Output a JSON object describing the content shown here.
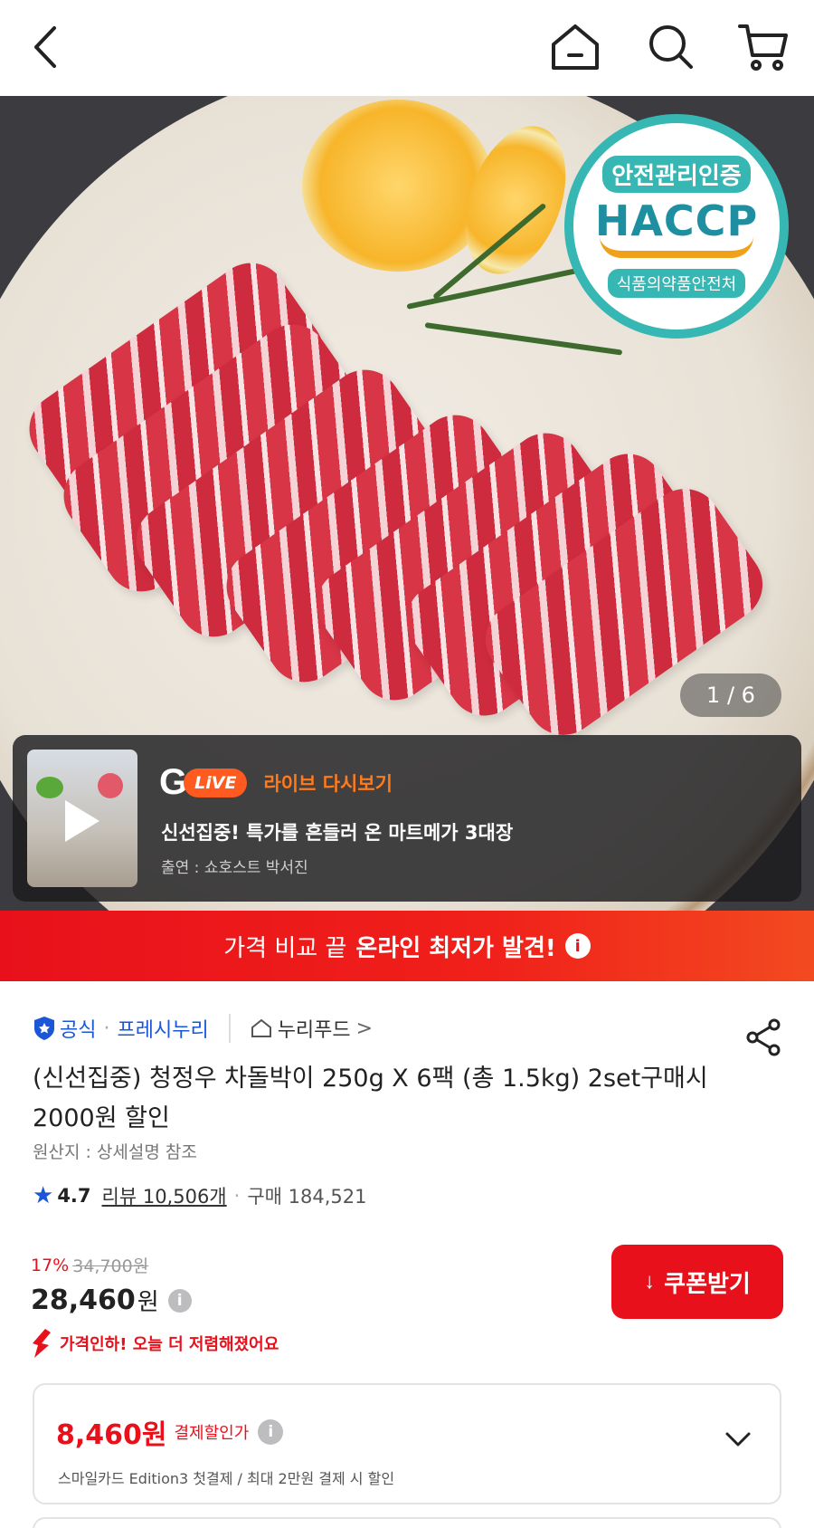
{
  "header": {
    "back_icon": "chevron-left-icon",
    "home_icon": "home-icon",
    "search_icon": "search-icon",
    "cart_icon": "cart-icon"
  },
  "hero": {
    "badge": {
      "top": "안전관리인증",
      "main": "HACCP",
      "bottom": "식품의약품안전처"
    },
    "counter": "1 / 6"
  },
  "live": {
    "logo_g": "G",
    "logo_live": "LiVE",
    "replay_label": "라이브 다시보기",
    "title": "신선집중! 특가를 흔들러 온 마트메가 3대장",
    "cast": "출연 : 쇼호스트 박서진"
  },
  "banner": {
    "text_plain": "가격 비교 끝",
    "text_bold": "온라인 최저가 발견!",
    "info_glyph": "i"
  },
  "product": {
    "badge_official": "공식",
    "brand": "프레시누리",
    "shop": "누리푸드",
    "shop_chevron": ">",
    "title": "(신선집중) 청정우 차돌박이 250g X 6팩 (총 1.5kg) 2set구매시 2000원 할인",
    "origin": "원산지 : 상세설명 참조",
    "rating": "4.7",
    "reviews": "리뷰 10,506개",
    "purchases": "구매 184,521",
    "discount_rate": "17%",
    "original_price": "34,700원",
    "price": "28,460",
    "price_unit": "원",
    "price_cut_note": "가격인하! 오늘 더 저렴해졌어요",
    "coupon_button": "쿠폰받기",
    "coupon_icon_glyph": "↓"
  },
  "payment": {
    "amount": "8,460원",
    "label": "결제할인가",
    "info_glyph": "i",
    "description": "스마일카드 Edition3 첫결제 / 최대 2만원 결제 시 할인"
  },
  "colors": {
    "accent_red": "#e8111b",
    "official_blue": "#1a56d6",
    "haccp_teal": "#37b7b3"
  }
}
